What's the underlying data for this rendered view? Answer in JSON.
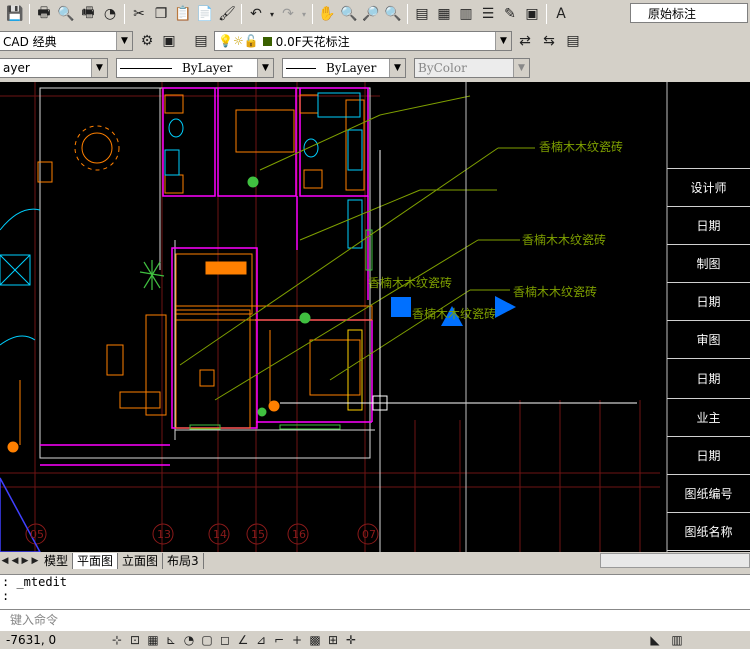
{
  "toolbar1": {
    "icons": [
      "save-icon",
      "print-icon",
      "print-preview-icon",
      "publish-icon",
      "3d-icon",
      "cut-icon",
      "copy-icon",
      "paste-icon",
      "paste-special-icon",
      "match-properties-icon",
      "undo-icon",
      "redo-icon",
      "pan-icon",
      "zoom-realtime-icon",
      "zoom-window-icon",
      "zoom-previous-icon",
      "properties-icon",
      "design-center-icon",
      "tool-palettes-icon",
      "sheet-set-icon",
      "markup-icon",
      "calculator-icon"
    ],
    "textstyle_value": "原始标注"
  },
  "toolbar2": {
    "workspace_value": "CAD 经典",
    "layer_value": "0.0F天花标注"
  },
  "toolbar3": {
    "color_value": "ayer",
    "linetype_value": "ByLayer",
    "lineweight_value": "ByLayer",
    "plotstyle_value": "ByColor"
  },
  "drawing": {
    "annotations": [
      "香楠木木纹瓷砖",
      "香楠木木纹瓷砖",
      "香楠木木纹瓷砖",
      "香楠木木纹瓷砖",
      "香楠木木纹瓷砖"
    ],
    "grid_labels": [
      "05",
      "13",
      "14",
      "15",
      "16",
      "07"
    ]
  },
  "title_block": {
    "rows": [
      "设计师",
      "日期",
      "制图",
      "日期",
      "审图",
      "日期",
      "业主",
      "日期",
      "图纸编号",
      "图纸名称"
    ]
  },
  "layout_tabs": {
    "tabs": [
      "模型",
      "平面图",
      "立面图",
      "布局3"
    ],
    "active_index": 1
  },
  "command": {
    "line1": ":  _mtedit",
    "line2": ":",
    "prompt": "键入命令"
  },
  "status": {
    "coordinates": "-7631, 0"
  },
  "colors": {
    "wall": "#ff00ff",
    "furniture": "#ff8000",
    "annotation": "#7fa000",
    "blue_marker": "#0070ff",
    "grid_red": "#8a1a1a"
  }
}
